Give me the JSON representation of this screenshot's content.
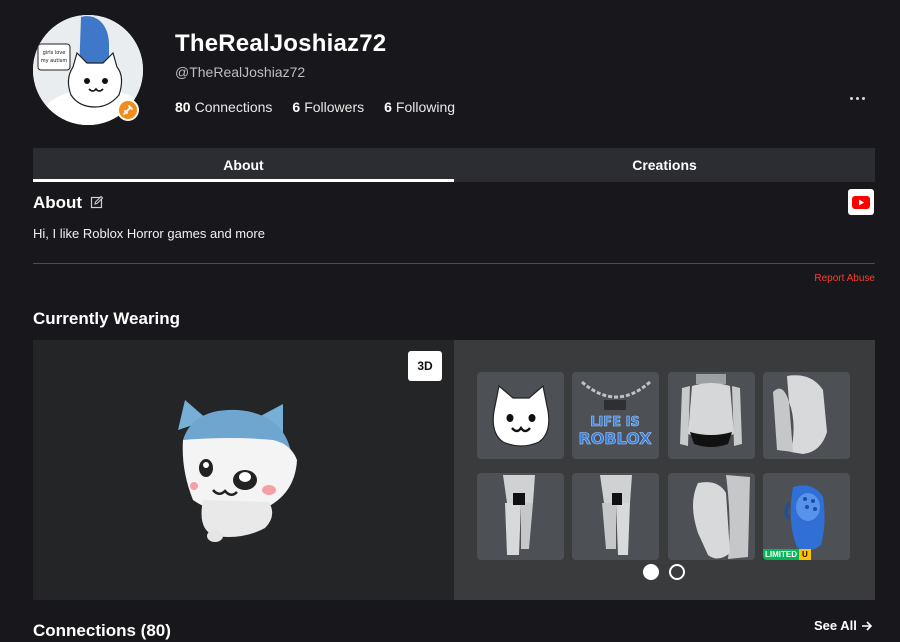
{
  "profile": {
    "display_name": "TheRealJoshiaz72",
    "username": "@TheRealJoshiaz72",
    "avatar_sign_text": "girls love my autism",
    "stats": [
      {
        "value": "80",
        "label": "Connections"
      },
      {
        "value": "6",
        "label": "Followers"
      },
      {
        "value": "6",
        "label": "Following"
      }
    ]
  },
  "tabs": [
    {
      "label": "About",
      "active": true
    },
    {
      "label": "Creations",
      "active": false
    }
  ],
  "about": {
    "title": "About",
    "description": "Hi, I like Roblox Horror games and more",
    "report_label": "Report Abuse"
  },
  "wearing": {
    "title": "Currently Wearing",
    "view_toggle_label": "3D",
    "items": [
      {
        "icon": "cat-face-icon"
      },
      {
        "icon": "life-is-roblox-chain-icon",
        "text": "LIFE IS ROBLOX"
      },
      {
        "icon": "torso-underwear-icon"
      },
      {
        "icon": "right-arm-icon"
      },
      {
        "icon": "left-leg-icon"
      },
      {
        "icon": "right-leg-icon"
      },
      {
        "icon": "left-arm-icon"
      },
      {
        "icon": "blue-clog-icon",
        "badge": "LIMITED",
        "badge_suffix": "U"
      }
    ],
    "pages": 2,
    "current_page": 1
  },
  "connections": {
    "title": "Connections (80)",
    "see_all_label": "See All"
  },
  "colors": {
    "background": "#18181c",
    "tab_bar": "#2b2d32",
    "premium_badge": "#f28c1c",
    "report": "#ff3b30",
    "limited_green": "#02b757",
    "limited_yellow": "#ffc000",
    "avatar_blue": "#6fa6cf"
  }
}
